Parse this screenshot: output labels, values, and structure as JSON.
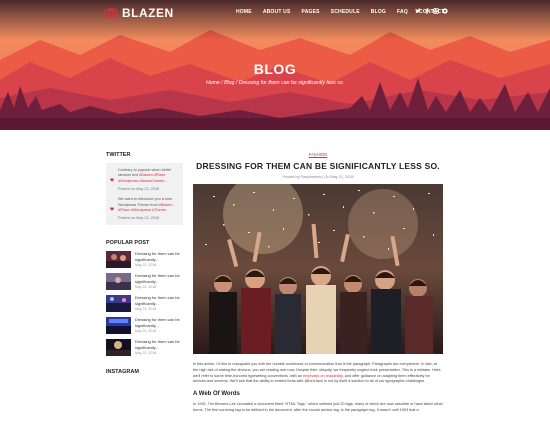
{
  "brand": {
    "name": "BLAZEN",
    "accent": "#e02b3f"
  },
  "nav": {
    "items": [
      "HOME",
      "ABOUT US",
      "PAGES",
      "SCHEDULE",
      "BLOG",
      "FAQ",
      "CONTACT"
    ],
    "social_icons": [
      "twitter-icon",
      "facebook-icon",
      "instagram-icon",
      "dribbble-icon"
    ]
  },
  "hero": {
    "title": "BLOG",
    "breadcrumb": "Home / Blog / Dressing for them can be significantly less so."
  },
  "sidebar": {
    "twitter_title": "TWITTER",
    "tweets": [
      {
        "text_a": "Contrary to popular when belief random text ",
        "tags_a": "#Blazen #Place #Wordpress #AwesChester...",
        "date": "Posted on May 22, 2018"
      },
      {
        "text_a": "We want to introduce you a new Wordpress Theme from ",
        "tags_a": "#Blazen #Place #Wordpress #Theme.",
        "date": "Posted on May 22, 2018"
      }
    ],
    "popular_title": "POPULAR POST",
    "popular": [
      {
        "title": "Dressing for them can be significantly...",
        "date": "May 21, 2018"
      },
      {
        "title": "Dressing for them can be significantly...",
        "date": "May 21, 2018"
      },
      {
        "title": "Dressing for them can be significantly...",
        "date": "May 21, 2018"
      },
      {
        "title": "Dressing for them can be significantly...",
        "date": "May 21, 2018"
      },
      {
        "title": "Dressing for them can be significantly...",
        "date": "May 21, 2018"
      }
    ],
    "instagram_title": "INSTAGRAM"
  },
  "post": {
    "category": "FASHION",
    "title": "DRESSING FOR THEM CAN BE SIGNIFICANTLY LESS SO.",
    "meta": "Posted by Pasythemes | On May 21, 2018",
    "para1_a": "In this article, I'd like to reacquaint you with the humble workhorse of communication that is the paragraph. Paragraphs are everywhere. In fact, at the high risk of stating the obvious, you are reading one now. Despite their ubiquity, we frequently neglect their presentation. This is a mistake. Here, we'll refer to some time-honored typesetting conventions, with an ",
    "para1_link": "emphasis on readability",
    "para1_b": ", and offer guidance on adapting them effectively for devices and screens. We'll see that the ability to embed fonts with @font-face is not by itself a solution to all of our typographic challenges.",
    "subheading": "A Web Of Words",
    "para2": "In 1992, Tim Berners-Lee circulated a document titled \"HTML Tags,\" which outlined just 20 tags, many of which are now obsolete or have taken other forms. The first surviving tag to be defined in the document, after the crucial anchor tag, is the paragraph tag. It wasn't until 1993 that a"
  }
}
